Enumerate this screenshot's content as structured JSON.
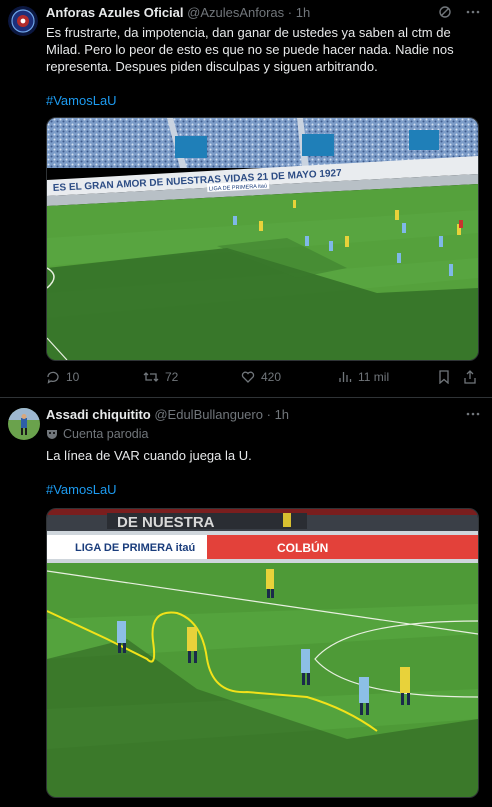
{
  "tweet1": {
    "display_name": "Anforas Azules Oficial",
    "handle": "@AzulesAnforas",
    "separator": "·",
    "time": "1h",
    "text": "Es frustrarte, da impotencia, dan ganar de ustedes ya saben al ctm de Milad. Pero lo peor de esto es que no se puede hacer nada. Nadie nos representa. Despues piden disculpas y siguen arbitrando.",
    "hashtag": "#VamosLaU",
    "media_banner": "ES EL GRAN AMOR DE NUESTRAS VIDAS 21 DE MAYO 1927",
    "media_board": "LIGA DE PRIMERA itaú",
    "actions": {
      "replies": "10",
      "reposts": "72",
      "likes": "420",
      "views": "11 mil"
    }
  },
  "tweet2": {
    "display_name": "Assadi chiquitito",
    "handle": "@EdulBullanguero",
    "separator": "·",
    "time": "1h",
    "parody_label": "Cuenta parodia",
    "text": "La línea de VAR cuando juega la U.",
    "hashtag": "#VamosLaU",
    "media_board_left": "LIGA DE PRIMERA itaú",
    "media_board_right": "COLBÚN",
    "media_banner": "DE NUESTRA"
  },
  "colors": {
    "background": "#000000",
    "text": "#e7e9ea",
    "muted": "#71767b",
    "link": "#1d9bf0",
    "divider": "#2f3336",
    "pitch": "#4f9a3a",
    "var_line": "#f2e21a"
  },
  "icons": [
    "grok-icon",
    "more-icon",
    "reply-icon",
    "repost-icon",
    "like-icon",
    "views-icon",
    "bookmark-icon",
    "share-icon",
    "parody-mask-icon"
  ]
}
